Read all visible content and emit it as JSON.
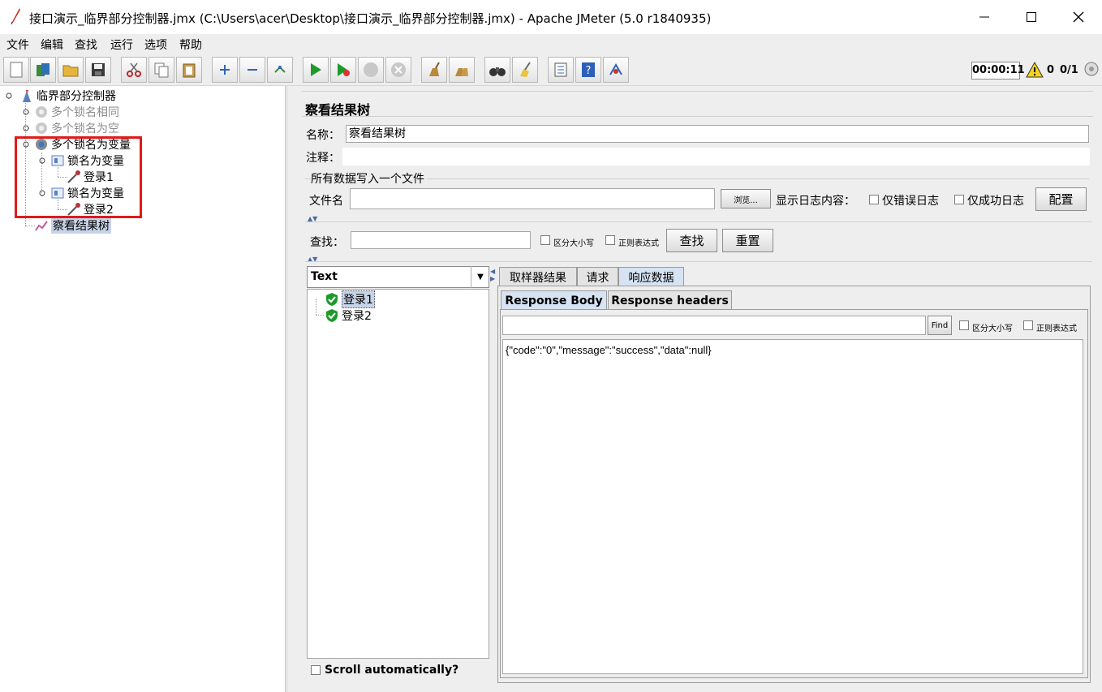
{
  "window": {
    "title": "接口演示_临界部分控制器.jmx (C:\\Users\\acer\\Desktop\\接口演示_临界部分控制器.jmx) - Apache JMeter (5.0 r1840935)"
  },
  "menu": [
    "文件",
    "编辑",
    "查找",
    "运行",
    "选项",
    "帮助"
  ],
  "toolbar": {
    "timer": "00:00:11",
    "warnings": "0",
    "threads": "0/1"
  },
  "tree": {
    "root": "临界部分控制器",
    "nodes": [
      {
        "label": "多个锁名相同"
      },
      {
        "label": "多个锁名为空"
      },
      {
        "label": "多个锁名为变量"
      },
      {
        "label": "锁名为变量"
      },
      {
        "label": "登录1"
      },
      {
        "label": "锁名为变量"
      },
      {
        "label": "登录2"
      },
      {
        "label": "察看结果树"
      }
    ]
  },
  "panel": {
    "title": "察看结果树",
    "name_label": "名称：",
    "name_value": "察看结果树",
    "comment_label": "注释：",
    "file_group_title": "所有数据写入一个文件",
    "file_label": "文件名",
    "browse_label": "浏览...",
    "log_label": "显示日志内容：",
    "errors_only": "仅错误日志",
    "success_only": "仅成功日志",
    "configure": "配置",
    "search_label": "查找：",
    "case_sensitive": "区分大小写",
    "regex": "正则表达式",
    "find_btn": "查找",
    "reset_btn": "重置"
  },
  "results": {
    "renderer": "Text",
    "samples": [
      "登录1",
      "登录2"
    ],
    "scroll_auto": "Scroll automatically?",
    "tabs": [
      "取样器结果",
      "请求",
      "响应数据"
    ],
    "subtabs": [
      "Response Body",
      "Response headers"
    ],
    "find_btn": "Find",
    "case_sensitive": "区分大小写",
    "regex": "正则表达式",
    "body": "{\"code\":\"0\",\"message\":\"success\",\"data\":null}"
  },
  "colors": {
    "highlight_box": "#e01a1a",
    "panel_bg": "#eeeeee",
    "active_tab": "#d6e3f3"
  }
}
